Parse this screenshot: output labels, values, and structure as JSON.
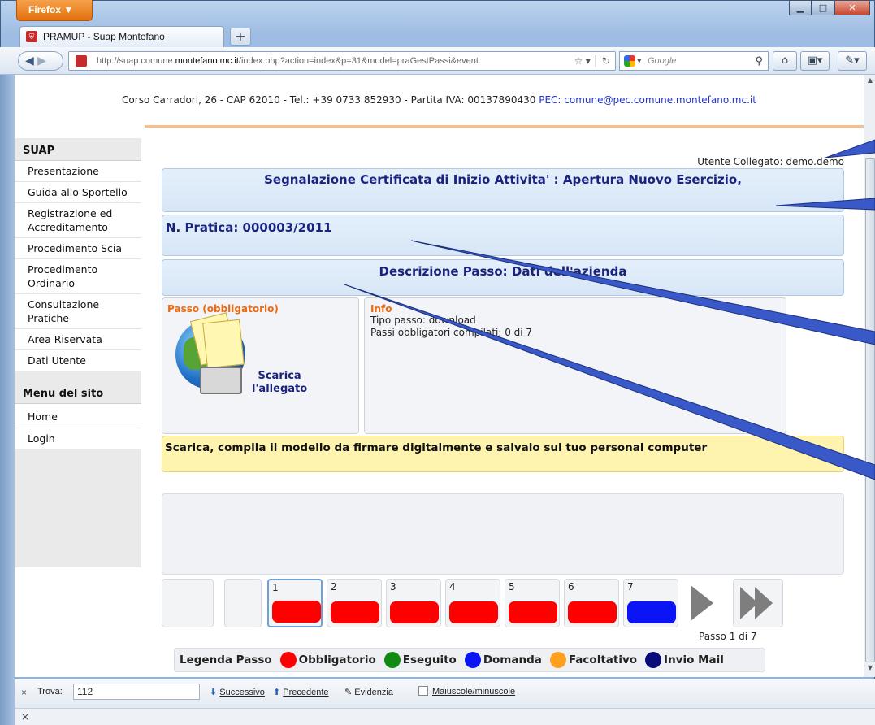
{
  "browser": {
    "menu_button": "Firefox ▼",
    "tab_title": "PRAMUP - Suap Montefano",
    "new_tab": "+",
    "url_prefix": "http://suap.comune.",
    "url_domain": "montefano.mc.it",
    "url_suffix": "/index.php?action=index&p=31&model=praGestPassi&event:",
    "search_engine": "Google",
    "icons": [
      "back-icon",
      "forward-icon",
      "star-icon",
      "reload-icon",
      "google-icon",
      "magnifier-icon",
      "home-icon",
      "bookmark-icon"
    ]
  },
  "header": {
    "address": "Corso Carradori, 26 - CAP 62010 - Tel.: +39 0733 852930 - Partita IVA: 00137890430",
    "pec": "PEC: comune@pec.comune.montefano.mc.it"
  },
  "sidebar": {
    "section1_title": "SUAP",
    "items": [
      "Presentazione",
      "Guida allo Sportello",
      "Registrazione ed Accreditamento",
      "Procedimento Scia",
      "Procedimento Ordinario",
      "Consultazione Pratiche",
      "Area Riservata",
      "Dati Utente"
    ],
    "section2_title": "Menu del sito",
    "items2": [
      "Home",
      "Login"
    ]
  },
  "main": {
    "user": "Utente Collegato: demo.demo",
    "title": "Segnalazione Certificata di Inizio Attivita' : Apertura Nuovo Esercizio,",
    "pratica": "N. Pratica: 000003/2011",
    "descrizione": "Descrizione Passo: Dati dell'azienda",
    "passo_label": "Passo (obbligatorio)",
    "scarica_1": "Scarica",
    "scarica_2": "l'allegato",
    "info_label": "Info",
    "tipo_passo": "Tipo passo: download",
    "passi_obbligatori": "Passi obbligatori compilati: 0 di 7",
    "instruction": "Scarica, compila il modello da firmare digitalmente e salvalo sul tuo personal computer",
    "steps": [
      {
        "n": "1",
        "status": "Obbligatorio"
      },
      {
        "n": "2",
        "status": "Obbligatorio"
      },
      {
        "n": "3",
        "status": "Obbligatorio"
      },
      {
        "n": "4",
        "status": "Obbligatorio"
      },
      {
        "n": "5",
        "status": "Obbligatorio"
      },
      {
        "n": "6",
        "status": "Obbligatorio"
      },
      {
        "n": "7",
        "status": "Domanda"
      }
    ],
    "step_count": "Passo 1 di 7",
    "legend": {
      "title": "Legenda Passo",
      "items": [
        "Obbligatorio",
        "Eseguito",
        "Domanda",
        "Facoltativo",
        "Invio Mail"
      ]
    }
  },
  "colors": {
    "obbligatorio": "#ff0000",
    "eseguito": "#108a10",
    "domanda": "#0a14f5",
    "facoltativo": "#ffa020",
    "invio_mail": "#0a0a7a",
    "accent_text": "#1a237e",
    "orange_label": "#ee6a10"
  },
  "findbar": {
    "close": "×",
    "label": "Trova:",
    "value": "112",
    "next": "Successivo",
    "prev": "Precedente",
    "highlight": "Evidenzia",
    "match_case": "Maiuscole/minuscole"
  },
  "statusbar": {
    "close": "×"
  }
}
